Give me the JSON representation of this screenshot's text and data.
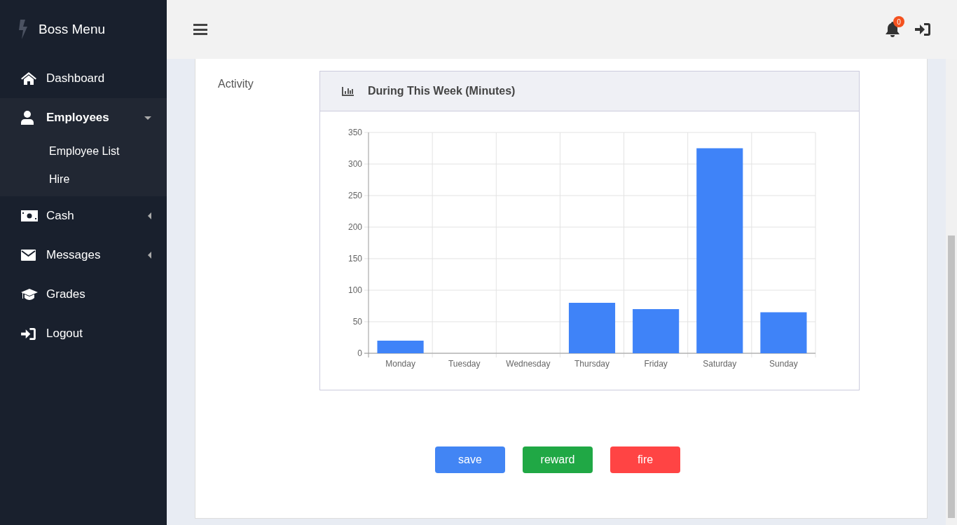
{
  "sidebar": {
    "brand": "Boss Menu",
    "items": [
      {
        "label": "Dashboard",
        "selected": false
      },
      {
        "label": "Employees",
        "selected": true,
        "expanded": true,
        "children": [
          {
            "label": "Employee List"
          },
          {
            "label": "Hire"
          }
        ]
      },
      {
        "label": "Cash",
        "selected": false,
        "expanded": false
      },
      {
        "label": "Messages",
        "selected": false,
        "expanded": false
      },
      {
        "label": "Grades",
        "selected": false
      },
      {
        "label": "Logout",
        "selected": false
      }
    ]
  },
  "header": {
    "notification_count": "0"
  },
  "activity": {
    "label": "Activity",
    "card_title": "During This Week (Minutes)",
    "chart_data": {
      "type": "bar",
      "categories": [
        "Monday",
        "Tuesday",
        "Wednesday",
        "Thursday",
        "Friday",
        "Saturday",
        "Sunday"
      ],
      "grid": true,
      "series": [
        {
          "color": "#3f83f8",
          "values": [
            20,
            0,
            0,
            80,
            70,
            325,
            65
          ]
        }
      ],
      "ylim": [
        0,
        350
      ],
      "yticks": [
        0,
        50,
        100,
        150,
        200,
        250,
        300,
        350
      ]
    }
  },
  "buttons": [
    {
      "label": "save",
      "kind": "primary"
    },
    {
      "label": "reward",
      "kind": "success"
    },
    {
      "label": "fire",
      "kind": "danger"
    }
  ]
}
